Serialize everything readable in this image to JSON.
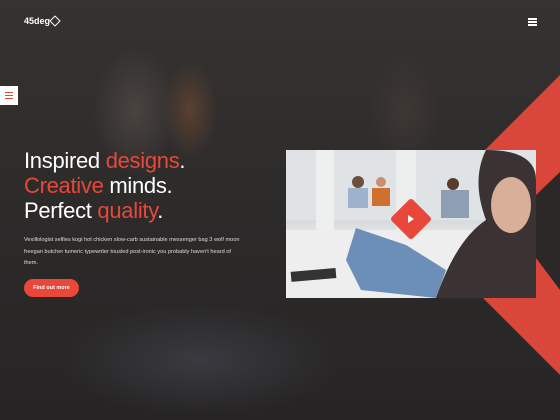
{
  "header": {
    "logo_text": "45deg",
    "menu_icon": "hamburger-icon"
  },
  "side_widget": {
    "icon": "settings-sliders-icon"
  },
  "hero": {
    "line1": {
      "a": "Inspired ",
      "b": "designs",
      "c": "."
    },
    "line2": {
      "a": "Creative",
      "b": " minds."
    },
    "line3": {
      "a": "Perfect ",
      "b": "quality",
      "c": "."
    },
    "description": "Vexillologist selfies kogi hot chicken slow-carb sustainable messenger bag 3 wolf moon freegan butcher tumeric typewriter tousled post-ironic you probably haven't heard of them.",
    "cta_label": "Find out more"
  },
  "video": {
    "play_icon": "play-icon"
  },
  "colors": {
    "accent": "#e8473a",
    "background": "#2a2827"
  }
}
